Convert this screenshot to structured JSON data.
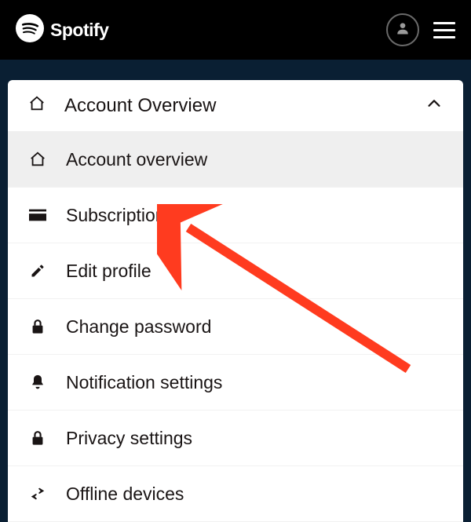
{
  "brand": "Spotify",
  "header": {
    "title": "Account Overview"
  },
  "menu": {
    "items": [
      {
        "label": "Account overview",
        "icon": "home-icon",
        "active": true
      },
      {
        "label": "Subscription",
        "icon": "card-icon",
        "active": false
      },
      {
        "label": "Edit profile",
        "icon": "pencil-icon",
        "active": false
      },
      {
        "label": "Change password",
        "icon": "lock-icon",
        "active": false
      },
      {
        "label": "Notification settings",
        "icon": "bell-icon",
        "active": false
      },
      {
        "label": "Privacy settings",
        "icon": "lock-icon",
        "active": false
      },
      {
        "label": "Offline devices",
        "icon": "swap-icon",
        "active": false
      }
    ]
  },
  "annotation": {
    "color": "#ff3b1f"
  }
}
